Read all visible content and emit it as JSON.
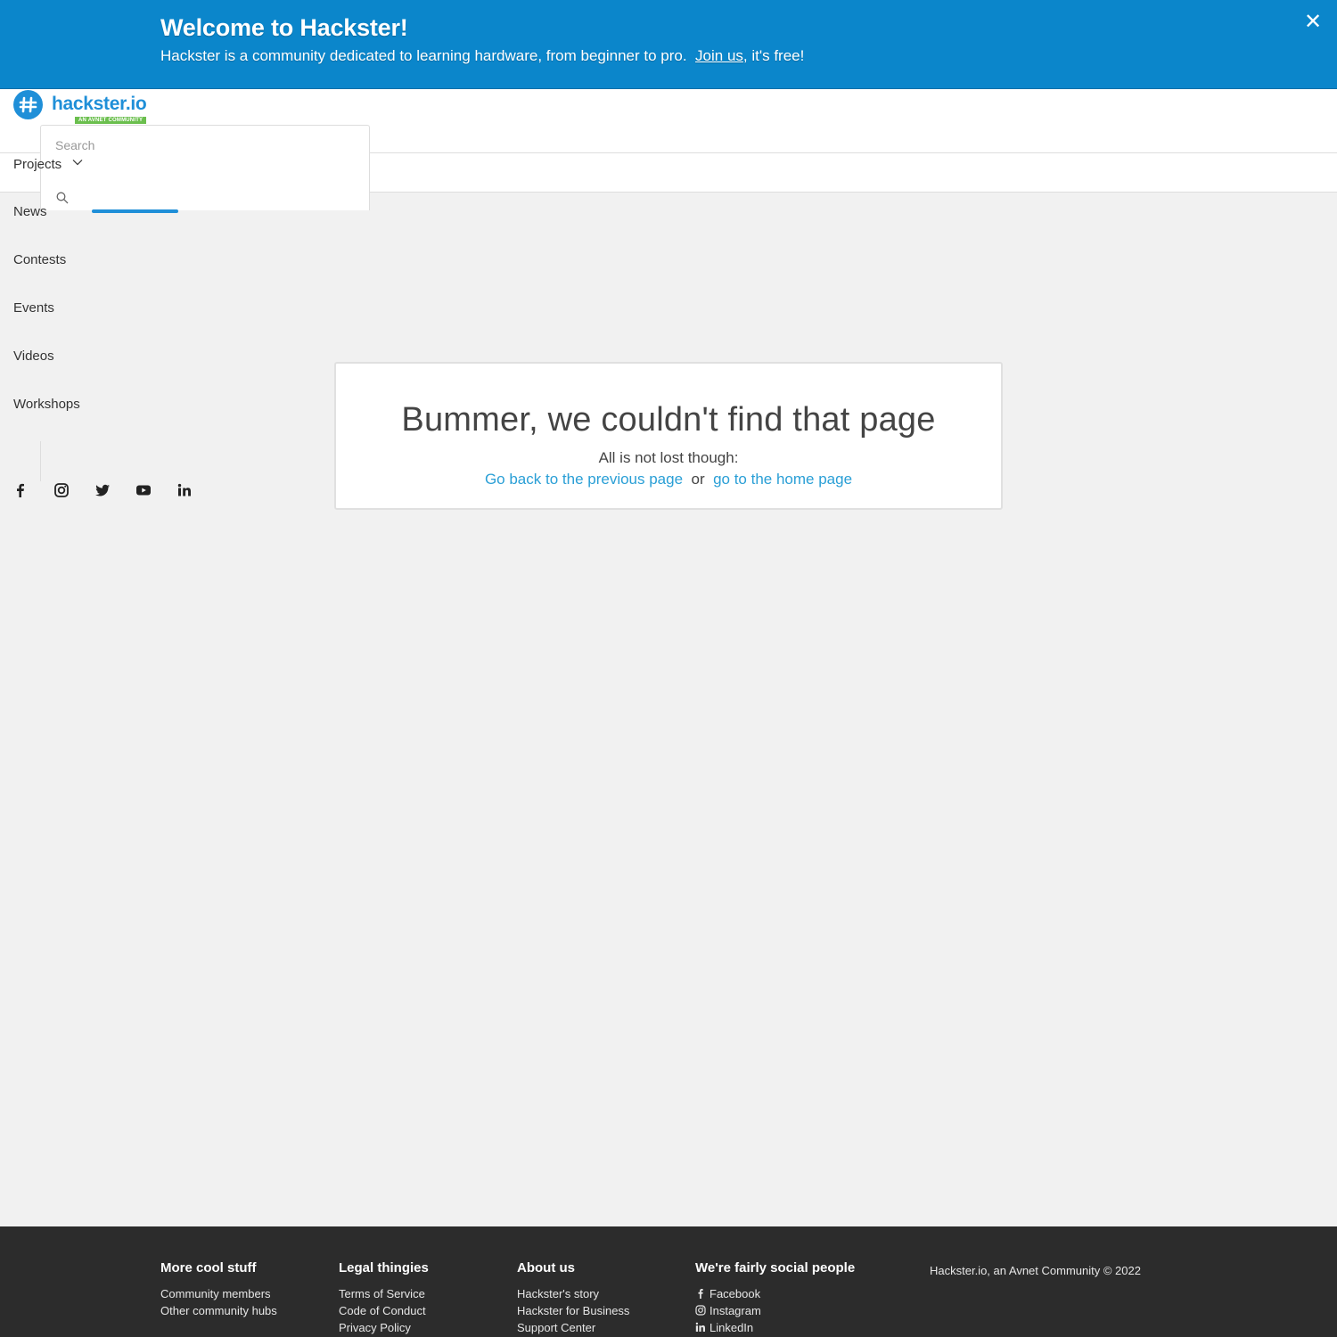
{
  "banner": {
    "title": "Welcome to Hackster!",
    "text_before": "Hackster is a community dedicated to learning hardware, from beginner to pro.",
    "join_link": "Join us",
    "text_after": ", it's free!",
    "close": "✕"
  },
  "header": {
    "logo_text": "hackster.io",
    "logo_tagline": "AN AVNET COMMUNITY",
    "search_placeholder": "Search"
  },
  "nav": {
    "items": [
      "Projects",
      "News",
      "Contests",
      "Events",
      "Videos",
      "Workshops"
    ]
  },
  "social": [
    "facebook-icon",
    "instagram-icon",
    "twitter-icon",
    "youtube-icon",
    "linkedin-icon"
  ],
  "error": {
    "title": "Bummer, we couldn't find that page",
    "subtitle": "All is not lost though:",
    "back_link": "Go back to the previous page",
    "or": "or",
    "home_link": "go to the home page"
  },
  "footer": {
    "columns": [
      {
        "heading": "More cool stuff",
        "links": [
          "Community members",
          "Other community hubs"
        ]
      },
      {
        "heading": "Legal thingies",
        "links": [
          "Terms of Service",
          "Code of Conduct",
          "Privacy Policy"
        ]
      },
      {
        "heading": "About us",
        "links": [
          "Hackster's story",
          "Hackster for Business",
          "Support Center"
        ]
      },
      {
        "heading": "We're fairly social people",
        "links": [
          "Facebook",
          "Instagram",
          "LinkedIn"
        ]
      }
    ],
    "copyright": "Hackster.io, an Avnet Community © 2022"
  },
  "colors": {
    "banner": "#0b86cb",
    "brand": "#1f8fd8",
    "link": "#2a9fd6",
    "footer": "#2c2c2c"
  }
}
